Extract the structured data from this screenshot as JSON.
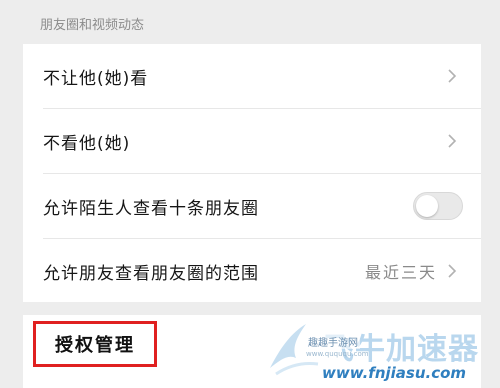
{
  "section_header": "朋友圈和视频动态",
  "rows": [
    {
      "label": "不让他(她)看",
      "type": "chevron"
    },
    {
      "label": "不看他(她)",
      "type": "chevron"
    },
    {
      "label": "允许陌生人查看十条朋友圈",
      "type": "toggle",
      "on": false
    },
    {
      "label": "允许朋友查看朋友圈的范围",
      "type": "value",
      "value": "最近三天"
    }
  ],
  "auth_row": {
    "label": "授权管理"
  },
  "watermark": {
    "main": "飞牛加速器",
    "url": "www.fnjiasu.com",
    "small": "趣趣手游网",
    "sub": "www.quququ.com"
  },
  "colors": {
    "highlight_border": "#e02020",
    "toggle_off": "#e9e9e9"
  }
}
